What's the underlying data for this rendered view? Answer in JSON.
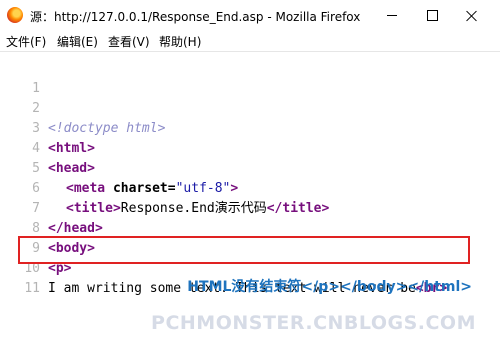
{
  "window": {
    "title": "源：http://127.0.0.1/Response_End.asp - Mozilla Firefox",
    "icon": "firefox-icon"
  },
  "menu": [
    {
      "label": "文件(F)"
    },
    {
      "label": "编辑(E)"
    },
    {
      "label": "查看(V)"
    },
    {
      "label": "帮助(H)"
    }
  ],
  "source": {
    "lines": [
      {
        "n": "1"
      },
      {
        "n": "2",
        "doctype": "<!doctype html>"
      },
      {
        "n": "3",
        "open": "<html>"
      },
      {
        "n": "4",
        "open": "<head>"
      },
      {
        "n": "5",
        "open": "<meta",
        "attr": " charset=",
        "val": "\"utf-8\"",
        "close": ">"
      },
      {
        "n": "6",
        "open": "<title>",
        "text": "Response.End演示代码",
        "close": "</title>"
      },
      {
        "n": "7",
        "open": "</head>"
      },
      {
        "n": "8",
        "open": "<body>"
      },
      {
        "n": "9",
        "open": "<p>"
      },
      {
        "n": "10",
        "text": "I am writing some text. This text will never be",
        "close": "<br>"
      },
      {
        "n": "11"
      }
    ]
  },
  "annotation": "HTML没有结束符</p></body></html>",
  "watermark": "PCHMONSTER.CNBLOGS.COM",
  "colors": {
    "tag": "#770f7d",
    "value": "#1a1aa6",
    "doctype": "#8c8cc8",
    "highlight": "#e02222",
    "annotation": "#1e73be",
    "line_number": "#b4b4b4"
  }
}
